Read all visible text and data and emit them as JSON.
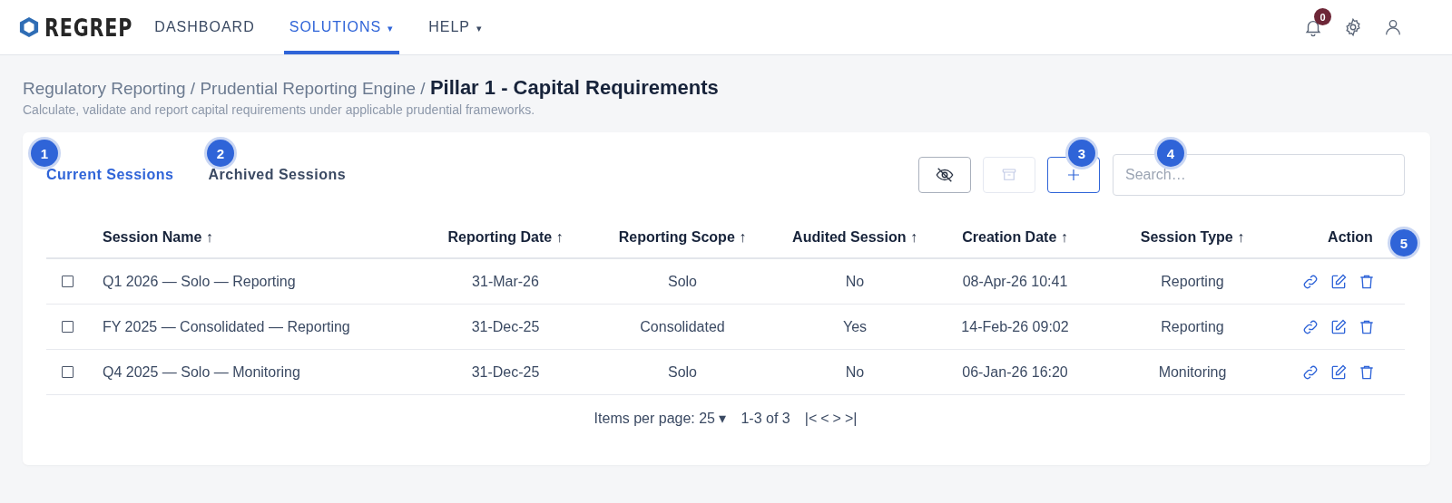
{
  "brand": {
    "name": "REGREP"
  },
  "nav": [
    {
      "label": "DASHBOARD",
      "selected": false
    },
    {
      "label": "SOLUTIONS",
      "selected": true,
      "caret": "▾"
    },
    {
      "label": "HELP",
      "selected": false,
      "caret": "▾"
    }
  ],
  "notifications": {
    "count": "0"
  },
  "breadcrumb": {
    "path": "Regulatory Reporting / Prudential Reporting Engine /",
    "current": "Pillar 1 - Capital Requirements"
  },
  "subtitle": "Calculate, validate and report capital requirements under applicable prudential frameworks.",
  "tabs": [
    {
      "label": "Current Sessions",
      "selected": true
    },
    {
      "label": "Archived Sessions",
      "selected": false
    }
  ],
  "toolbar": [
    {
      "kind": "hide",
      "disabled": false
    },
    {
      "kind": "archive",
      "disabled": true
    },
    {
      "kind": "add",
      "disabled": false
    }
  ],
  "search": {
    "placeholder": "Search…"
  },
  "table": {
    "columns": [
      "Session Name ↑",
      "Reporting Date ↑",
      "Reporting Scope ↑",
      "Audited Session ↑",
      "Creation Date ↑",
      "Session Type ↑",
      "Action"
    ],
    "rows": [
      {
        "checked": false,
        "cells": [
          "Q1 2026 — Solo — Reporting",
          "31-Mar-26",
          "Solo",
          "No",
          "08-Apr-26 10:41",
          "Reporting"
        ]
      },
      {
        "checked": false,
        "cells": [
          "FY 2025 — Consolidated — Reporting",
          "31-Dec-25",
          "Consolidated",
          "Yes",
          "14-Feb-26 09:02",
          "Reporting"
        ]
      },
      {
        "checked": false,
        "cells": [
          "Q4 2025 — Solo — Monitoring",
          "31-Dec-25",
          "Solo",
          "No",
          "06-Jan-26 16:20",
          "Monitoring"
        ]
      }
    ]
  },
  "pagination": {
    "per_page": "Items per page: 25 ▾",
    "range": "1-3 of 3",
    "controls": [
      "|<",
      "<",
      ">",
      ">|"
    ]
  },
  "callouts": [
    {
      "label": "1"
    },
    {
      "label": "2"
    },
    {
      "label": "3"
    },
    {
      "label": "4"
    },
    {
      "label": "5"
    }
  ]
}
